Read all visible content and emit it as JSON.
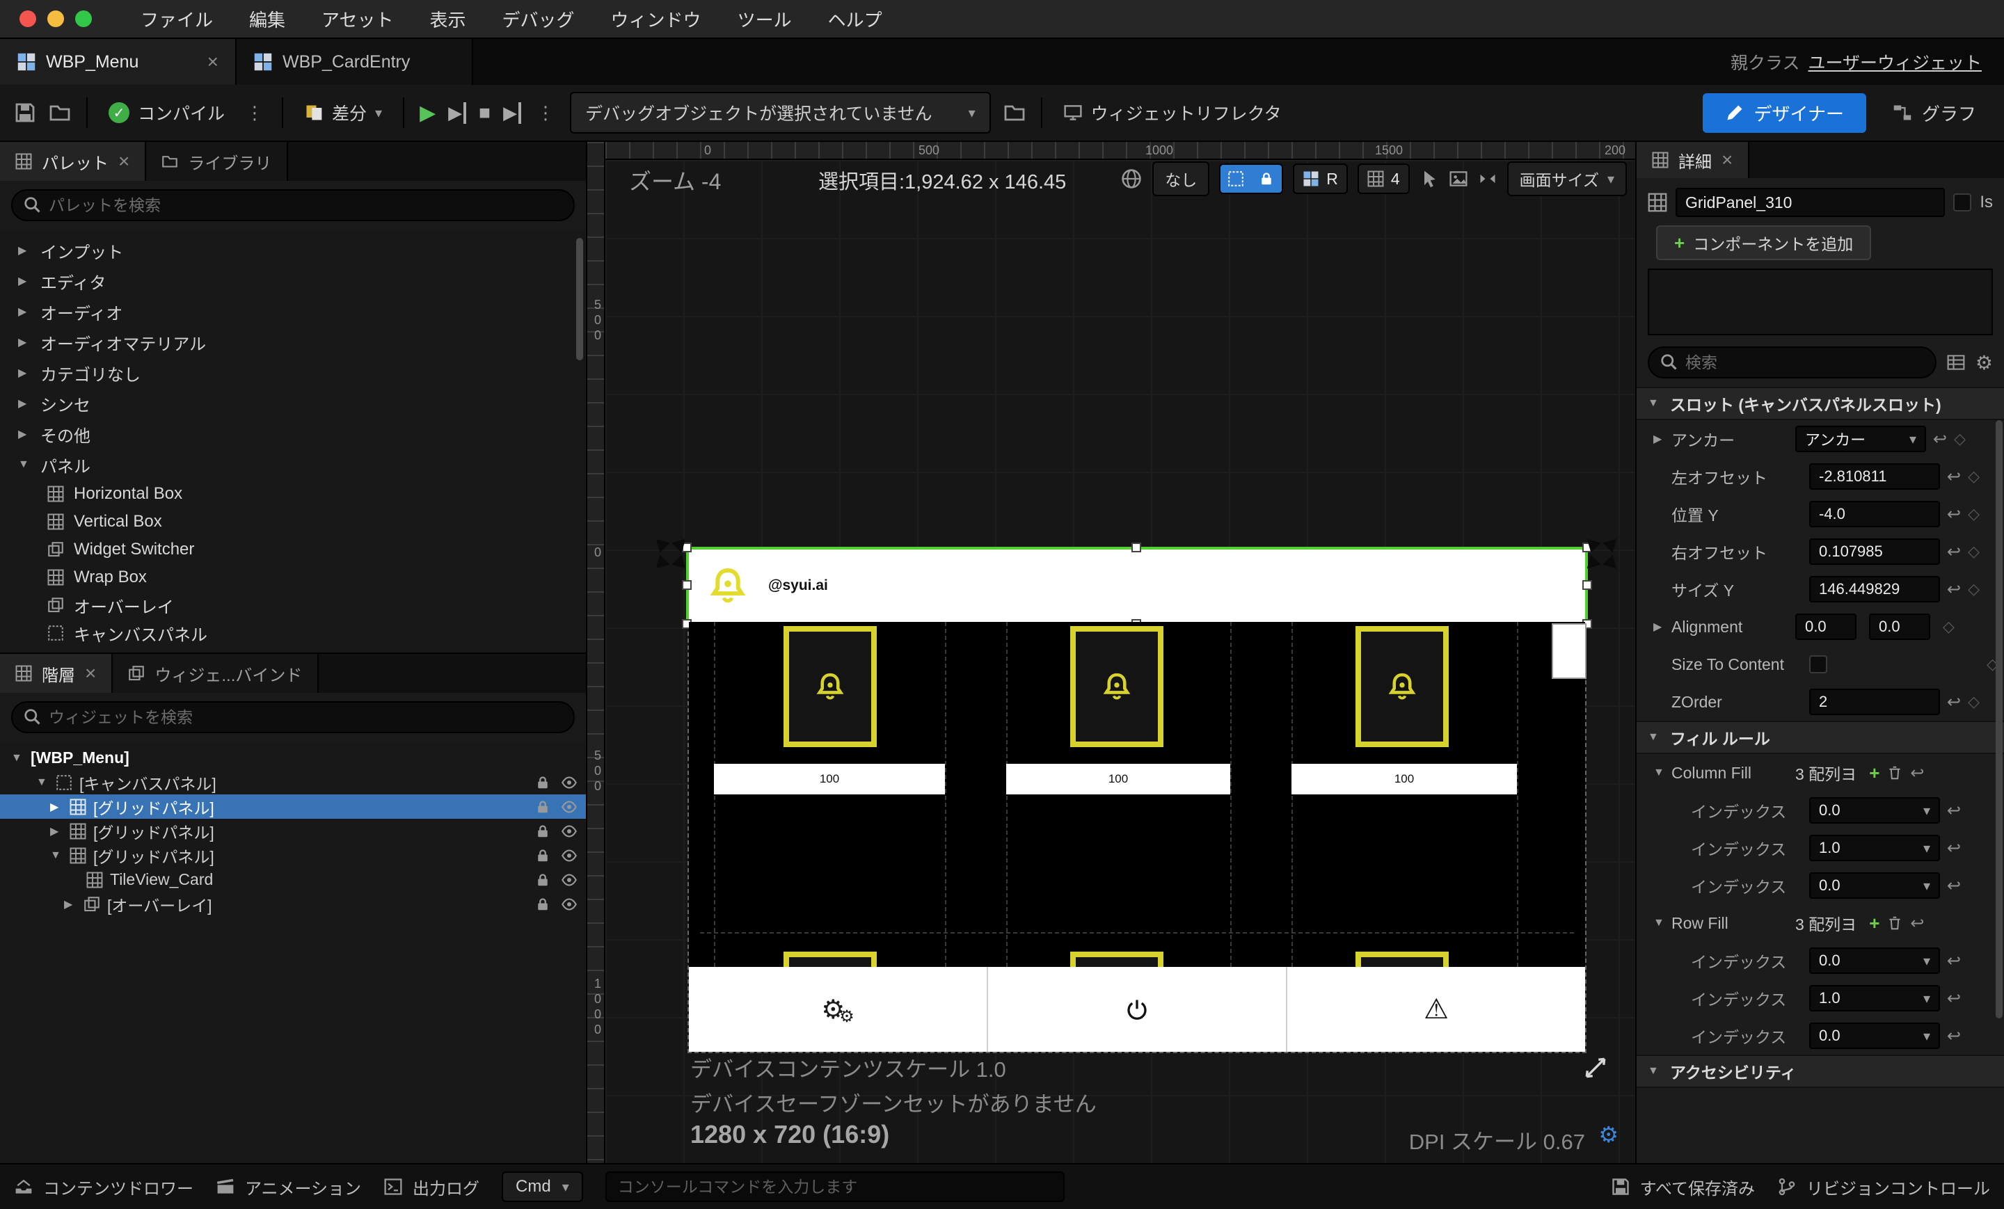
{
  "colors": {
    "designer_blue": "#1a72d9",
    "selection_blue": "#3873b5",
    "selection_green": "#53d02d",
    "card_yellow": "#d8d22e",
    "compile_green": "#3fae46"
  },
  "icons": {
    "triangle_right": "▶",
    "triangle_down": "▼",
    "chevron_down": "▾",
    "close": "×",
    "dots_vertical": "⋮",
    "play": "▶",
    "stop": "■",
    "check": "✓",
    "gear": "⚙",
    "warning": "⚠",
    "undo": "↩",
    "diamond": "◇",
    "plus": "+"
  },
  "window": {
    "menu_items": [
      "ファイル",
      "編集",
      "アセット",
      "表示",
      "デバッグ",
      "ウィンドウ",
      "ツール",
      "ヘルプ"
    ]
  },
  "tabs": {
    "active": "WBP_Menu",
    "inactive": "WBP_CardEntry",
    "parent_class_label": "親クラス",
    "parent_class_value": "ユーザーウィジェット"
  },
  "toolbar": {
    "compile": "コンパイル",
    "diff": "差分",
    "debug_dropdown": "デバッグオブジェクトが選択されていません",
    "widget_reflector": "ウィジェットリフレクタ",
    "designer": "デザイナー",
    "graph": "グラフ"
  },
  "palette": {
    "tab": "パレット",
    "library_tab": "ライブラリ",
    "search_placeholder": "パレットを検索",
    "categories": [
      "インプット",
      "エディタ",
      "オーディオ",
      "オーディオマテリアル",
      "カテゴリなし",
      "シンセ",
      "その他",
      "パネル"
    ],
    "panel_items": [
      "Horizontal Box",
      "Vertical Box",
      "Widget Switcher",
      "Wrap Box",
      "オーバーレイ",
      "キャンバスパネル"
    ]
  },
  "hierarchy": {
    "tab": "階層",
    "bind_tab": "ウィジェ...バインド",
    "search_placeholder": "ウィジェットを検索",
    "rows": [
      "[WBP_Menu]",
      "[キャンバスパネル]",
      "[グリッドパネル]",
      "[グリッドパネル]",
      "[グリッドパネル]",
      "TileView_Card",
      "[オーバーレイ]"
    ]
  },
  "viewport": {
    "zoom_label": "ズーム -4",
    "selection_label": "選択項目:1,924.62 x 146.45",
    "none_button": "なし",
    "r_button": "R",
    "grid_button": "4",
    "screen_size": "画面サイズ",
    "ruler_top": [
      "0",
      "500",
      "1000",
      "1500",
      "200"
    ],
    "ruler_left": [
      "500",
      "0",
      "500",
      "1000"
    ],
    "preview": {
      "username": "@syui.ai",
      "card_counts": [
        "100",
        "100",
        "100"
      ]
    },
    "status_line_1": "デバイスコンテンツスケール 1.0",
    "status_line_2": "デバイスセーフゾーンセットがありません",
    "resolution": "1280 x 720 (16:9)",
    "dpi_scale": "DPI スケール 0.67"
  },
  "details": {
    "tab": "詳細",
    "object_name": "GridPanel_310",
    "is_label": "Is",
    "add_component": "コンポーネントを追加",
    "search_placeholder": "検索",
    "slot_section": "スロット (キャンバスパネルスロット)",
    "anchor_label": "アンカー",
    "anchor_value": "アンカー",
    "left_offset_label": "左オフセット",
    "left_offset_value": "-2.810811",
    "position_y_label": "位置 Y",
    "position_y_value": "-4.0",
    "right_offset_label": "右オフセット",
    "right_offset_value": "0.107985",
    "size_y_label": "サイズ Y",
    "size_y_value": "146.449829",
    "alignment_label": "Alignment",
    "alignment_x": "0.0",
    "alignment_y": "0.0",
    "size_to_content_label": "Size To Content",
    "zorder_label": "ZOrder",
    "zorder_value": "2",
    "fill_section": "フィル ルール",
    "column_fill_label": "Column Fill",
    "column_fill_count": "3 配列ヨ",
    "row_fill_label": "Row Fill",
    "row_fill_count": "3 配列ヨ",
    "index_label": "インデックス",
    "column_fill_values": [
      "0.0",
      "1.0",
      "0.0"
    ],
    "row_fill_values": [
      "0.0",
      "1.0",
      "0.0"
    ],
    "accessibility_section": "アクセシビリティ"
  },
  "statusbar": {
    "content_drawer": "コンテンツドロワー",
    "animation": "アニメーション",
    "output_log": "出力ログ",
    "cmd": "Cmd",
    "console_placeholder": "コンソールコマンドを入力します",
    "save_status": "すべて保存済み",
    "revision_control": "リビジョンコントロール"
  }
}
